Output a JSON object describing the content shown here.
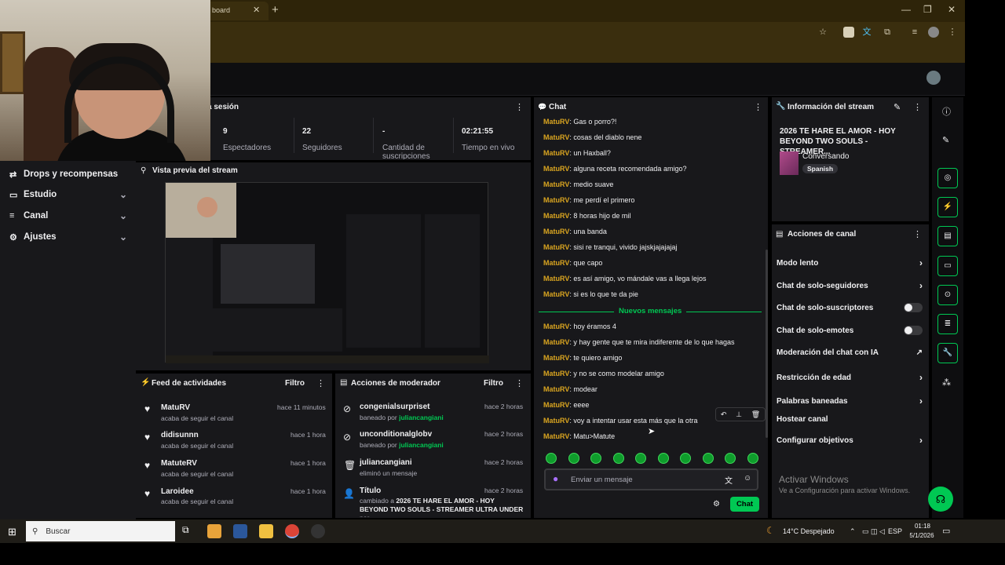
{
  "browser": {
    "tab_title": "board",
    "tab_close": "✕",
    "new_tab": "+",
    "min": "—",
    "restore": "❐",
    "close": "✕"
  },
  "session": {
    "title": "a sesión",
    "stats": [
      {
        "num": "9",
        "label": "Espectadores"
      },
      {
        "num": "22",
        "label": "Seguidores"
      },
      {
        "num": "-",
        "label": "Cantidad de suscripciones"
      },
      {
        "num": "02:21:55",
        "label": "Tiempo en vivo"
      }
    ]
  },
  "nav": {
    "items": [
      {
        "label": "Drops y recompensas",
        "icon": "⇄"
      },
      {
        "label": "Estudio",
        "icon": "▭"
      },
      {
        "label": "Canal",
        "icon": "≡"
      },
      {
        "label": "Ajustes",
        "icon": "⚙"
      }
    ]
  },
  "preview": {
    "title": "Vista previa del stream"
  },
  "activity": {
    "title": "Feed de actividades",
    "filter": "Filtro",
    "items": [
      {
        "name": "MatuRV",
        "desc": "acaba de seguir el canal",
        "time": "hace 11 minutos"
      },
      {
        "name": "didisunnn",
        "desc": "acaba de seguir el canal",
        "time": "hace 1 hora"
      },
      {
        "name": "MatuteRV",
        "desc": "acaba de seguir el canal",
        "time": "hace 1 hora"
      },
      {
        "name": "Laroidee",
        "desc": "acaba de seguir el canal",
        "time": "hace 1 hora"
      }
    ]
  },
  "mod": {
    "title": "Acciones de moderador",
    "filter": "Filtro",
    "items": [
      {
        "name": "congenialsurpriset",
        "pre": "baneado por ",
        "by": "juliancangiani",
        "time": "hace 2 horas"
      },
      {
        "name": "unconditionalglobv",
        "pre": "baneado por ",
        "by": "juliancangiani",
        "time": "hace 2 horas"
      },
      {
        "name": "juliancangiani",
        "pre": "eliminó un mensaje",
        "by": "",
        "time": "hace 2 horas"
      },
      {
        "name": "Título",
        "pre": "cambiado a ",
        "by": "2026 TE HARE EL AMOR - HOY BEYOND TWO SOULS - STREAMER ULTRA UNDER",
        "post": " por",
        "time": "hace 2 horas"
      }
    ]
  },
  "chat": {
    "title": "Chat",
    "messages_before": [
      {
        "user": "MatuRV",
        "text": "Gas o porro?!"
      },
      {
        "user": "MatuRV",
        "text": "cosas del diablo nene"
      },
      {
        "user": "MatuRV",
        "text": "un Haxball?"
      },
      {
        "user": "MatuRV",
        "text": "alguna receta recomendada amigo?"
      },
      {
        "user": "MatuRV",
        "text": "medio suave"
      },
      {
        "user": "MatuRV",
        "text": "me perdí el primero"
      },
      {
        "user": "MatuRV",
        "text": "8 horas hijo de mil"
      },
      {
        "user": "MatuRV",
        "text": "una banda"
      },
      {
        "user": "MatuRV",
        "text": "sisi re tranqui, vivido jajskjajajajaj"
      },
      {
        "user": "MatuRV",
        "text": "que capo"
      },
      {
        "user": "MatuRV",
        "text": "es así amigo, vo mándale vas a llega lejos"
      },
      {
        "user": "MatuRV",
        "text": "si es lo que te da pie"
      }
    ],
    "new_label": "Nuevos mensajes",
    "messages_after": [
      {
        "user": "MatuRV",
        "text": "hoy éramos 4"
      },
      {
        "user": "MatuRV",
        "text": "y hay gente que te mira indiferente de lo que hagas"
      },
      {
        "user": "MatuRV",
        "text": "te quiero amigo"
      },
      {
        "user": "MatuRV",
        "text": "y no se como modelar amigo"
      },
      {
        "user": "MatuRV",
        "text": "modear"
      },
      {
        "user": "MatuRV",
        "text": "eeee"
      },
      {
        "user": "MatuRV",
        "text": "voy a intentar usar esta más que la otra"
      },
      {
        "user": "MatuRV",
        "text": "Matu>Matute"
      }
    ],
    "placeholder": "Enviar un mensaje",
    "send": "Chat"
  },
  "info": {
    "title": "Información del stream",
    "stream_title": "2026 TE HARE EL AMOR - HOY BEYOND TWO SOULS - STREAMER...",
    "category": "Conversando",
    "tag": "Spanish"
  },
  "actions": {
    "title": "Acciones de canal",
    "items": [
      {
        "label": "Modo lento",
        "kind": "chev"
      },
      {
        "label": "Chat de solo-seguidores",
        "kind": "chev"
      },
      {
        "label": "Chat de solo-suscriptores",
        "kind": "toggle"
      },
      {
        "label": "Chat de solo-emotes",
        "kind": "toggle"
      },
      {
        "label": "Moderación del chat con IA",
        "kind": "ext"
      },
      {
        "label": "Restricción de edad",
        "kind": "chev"
      },
      {
        "label": "Palabras baneadas",
        "kind": "chev"
      },
      {
        "label": "Hostear canal",
        "kind": "none"
      },
      {
        "label": "Configurar objetivos",
        "kind": "chev"
      }
    ]
  },
  "windows": {
    "activate": "Activar Windows",
    "activate_sub": "Ve a Configuración para activar Windows.",
    "search": "Buscar",
    "weather": "14°C  Despejado",
    "lang": "ESP",
    "time": "01:18",
    "date": "5/1/2026"
  }
}
